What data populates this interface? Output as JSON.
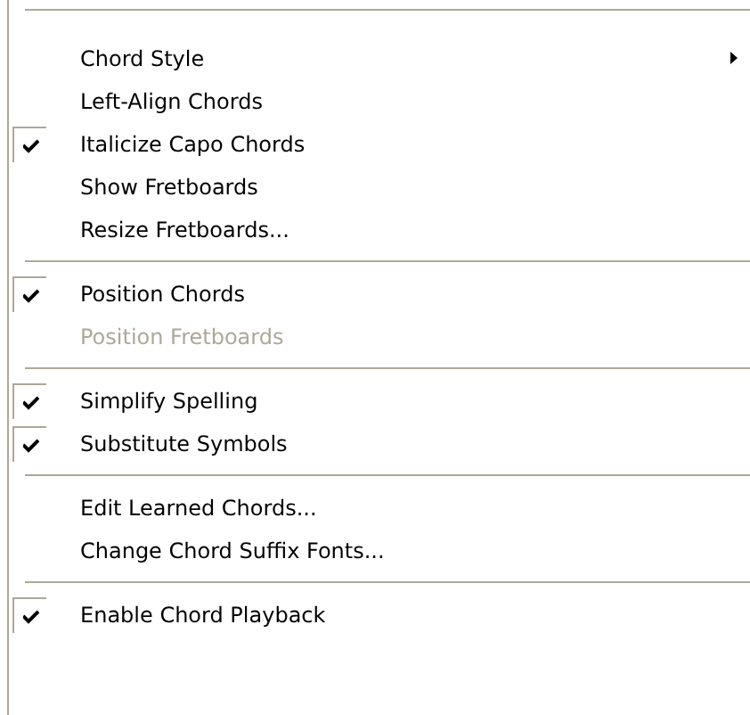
{
  "menu": {
    "items": [
      {
        "kind": "separator"
      },
      {
        "kind": "item",
        "label": "Chord Style",
        "checked": false,
        "disabled": false,
        "submenu": true
      },
      {
        "kind": "item",
        "label": "Left-Align Chords",
        "checked": false,
        "disabled": false,
        "submenu": false
      },
      {
        "kind": "item",
        "label": "Italicize Capo Chords",
        "checked": true,
        "disabled": false,
        "submenu": false
      },
      {
        "kind": "item",
        "label": "Show Fretboards",
        "checked": false,
        "disabled": false,
        "submenu": false
      },
      {
        "kind": "item",
        "label": "Resize Fretboards...",
        "checked": false,
        "disabled": false,
        "submenu": false
      },
      {
        "kind": "separator"
      },
      {
        "kind": "item",
        "label": "Position Chords",
        "checked": true,
        "disabled": false,
        "submenu": false
      },
      {
        "kind": "item",
        "label": "Position Fretboards",
        "checked": false,
        "disabled": true,
        "submenu": false
      },
      {
        "kind": "separator"
      },
      {
        "kind": "item",
        "label": "Simplify Spelling",
        "checked": true,
        "disabled": false,
        "submenu": false
      },
      {
        "kind": "item",
        "label": "Substitute Symbols",
        "checked": true,
        "disabled": false,
        "submenu": false
      },
      {
        "kind": "separator"
      },
      {
        "kind": "item",
        "label": "Edit Learned Chords...",
        "checked": false,
        "disabled": false,
        "submenu": false
      },
      {
        "kind": "item",
        "label": "Change Chord Suffix Fonts...",
        "checked": false,
        "disabled": false,
        "submenu": false
      },
      {
        "kind": "separator"
      },
      {
        "kind": "item",
        "label": "Enable Chord Playback",
        "checked": true,
        "disabled": false,
        "submenu": false
      }
    ]
  }
}
